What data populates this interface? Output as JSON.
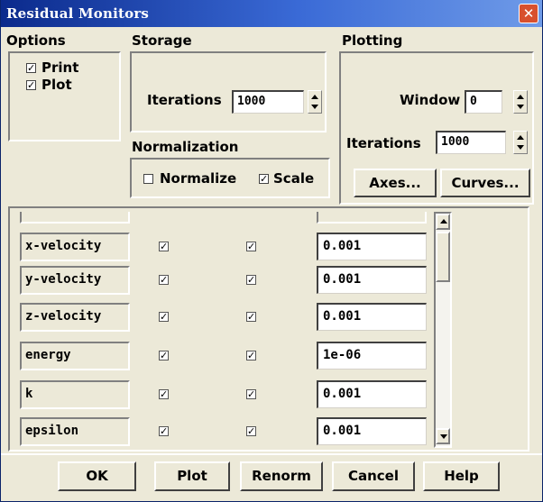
{
  "window": {
    "title": "Residual Monitors",
    "close_glyph": "✕"
  },
  "options": {
    "title": "Options",
    "print": {
      "label": "Print",
      "checked": true
    },
    "plot": {
      "label": "Plot",
      "checked": true
    }
  },
  "storage": {
    "title": "Storage",
    "iterations_label": "Iterations",
    "iterations_value": "1000"
  },
  "normalization": {
    "title": "Normalization",
    "normalize": {
      "label": "Normalize",
      "checked": false
    },
    "scale": {
      "label": "Scale",
      "checked": true
    }
  },
  "plotting": {
    "title": "Plotting",
    "window_label": "Window",
    "window_value": "0",
    "iterations_label": "Iterations",
    "iterations_value": "1000",
    "axes_button": "Axes...",
    "curves_button": "Curves..."
  },
  "residuals": [
    {
      "name": "x-velocity",
      "check1": true,
      "check2": true,
      "value": "0.001"
    },
    {
      "name": "y-velocity",
      "check1": true,
      "check2": true,
      "value": "0.001"
    },
    {
      "name": "z-velocity",
      "check1": true,
      "check2": true,
      "value": "0.001"
    },
    {
      "name": "energy",
      "check1": true,
      "check2": true,
      "value": "1e-06"
    },
    {
      "name": "k",
      "check1": true,
      "check2": true,
      "value": "0.001"
    },
    {
      "name": "epsilon",
      "check1": true,
      "check2": true,
      "value": "0.001"
    }
  ],
  "buttons": {
    "ok": "OK",
    "plot": "Plot",
    "renorm": "Renorm",
    "cancel": "Cancel",
    "help": "Help"
  },
  "check_glyph": "✓",
  "colors": {
    "title_bar_start": "#0b2a8c",
    "title_bar_end": "#6f9be8",
    "face": "#ece9d8",
    "close": "#d8502e"
  }
}
